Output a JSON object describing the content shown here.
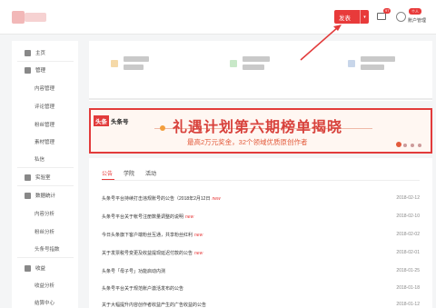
{
  "header": {
    "publish_label": "发表",
    "mail_count": "97",
    "user_badge": "个人",
    "user_name": "账户管理"
  },
  "sidebar": {
    "items": [
      {
        "type": "group",
        "label": "主页",
        "icon": "home-icon"
      },
      {
        "type": "group",
        "label": "管理",
        "icon": "manage-icon"
      },
      {
        "type": "sub",
        "label": "内容管理"
      },
      {
        "type": "sub",
        "label": "评论管理"
      },
      {
        "type": "sub",
        "label": "粉丝管理"
      },
      {
        "type": "sub",
        "label": "素材管理"
      },
      {
        "type": "sub",
        "label": "私信"
      },
      {
        "type": "group",
        "label": "实验室",
        "icon": "lab-icon"
      },
      {
        "type": "group",
        "label": "数据统计",
        "icon": "chart-icon"
      },
      {
        "type": "sub",
        "label": "内容分析"
      },
      {
        "type": "sub",
        "label": "粉丝分析"
      },
      {
        "type": "sub",
        "label": "头条号指数"
      },
      {
        "type": "group",
        "label": "收益",
        "icon": "revenue-icon"
      },
      {
        "type": "sub",
        "label": "收益分析"
      },
      {
        "type": "sub",
        "label": "结算中心"
      }
    ]
  },
  "banner": {
    "logo_tag": "头条",
    "logo_text": "头条号",
    "title": "礼遇计划第六期榜单揭晓",
    "subtitle": "最高2万元奖金，32个领域优质原创作者"
  },
  "news": {
    "tabs": [
      {
        "label": "公告",
        "active": true
      },
      {
        "label": "学院",
        "active": false
      },
      {
        "label": "活动",
        "active": false
      }
    ],
    "rows": [
      {
        "title": "头条号平台持续打击违规账号的公告（2018年2月12日",
        "new": true,
        "date": "2018-02-12"
      },
      {
        "title": "头条号平台关于帐号注册数量调整的说明",
        "new": true,
        "date": "2018-02-10"
      },
      {
        "title": "今日头条旗下客户端粉丝互通，共享粉丝红利",
        "new": true,
        "date": "2018-02-02"
      },
      {
        "title": "关于发票税号变更及收益提现延迟付款的公告",
        "new": true,
        "date": "2018-02-01"
      },
      {
        "title": "头条号「母子号」功能启动内测",
        "new": false,
        "date": "2018-01-25"
      },
      {
        "title": "头条号平台关于规范账户激活发布的公告",
        "new": false,
        "date": "2018-01-18"
      },
      {
        "title": "关于大幅提升内容创作者收益产生的广告收益的公告",
        "new": false,
        "date": "2018-01-12"
      }
    ],
    "new_label": "new"
  }
}
